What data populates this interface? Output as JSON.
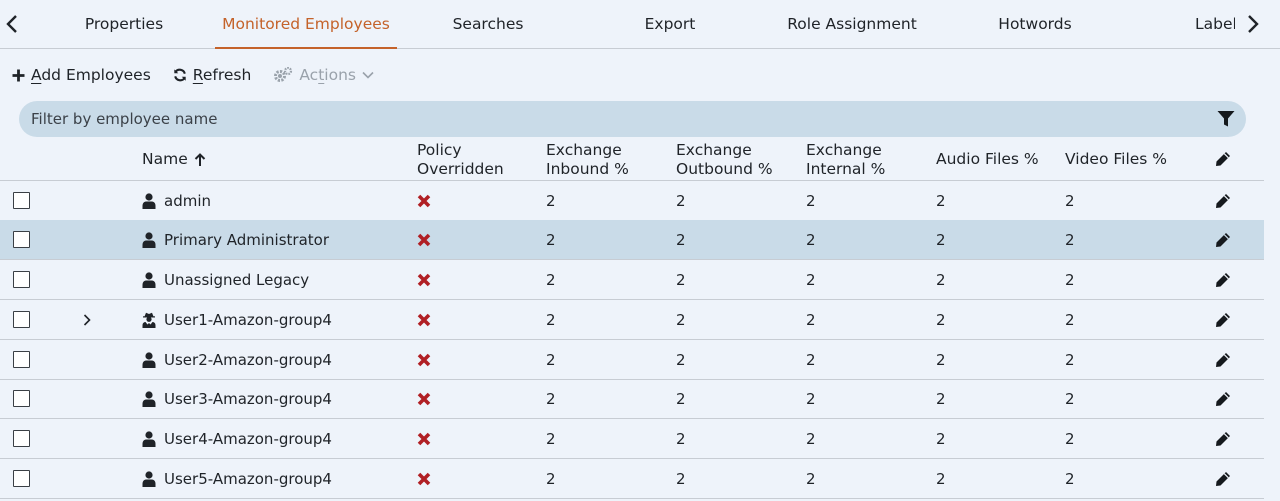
{
  "tabs": [
    {
      "label": "Properties",
      "active": false
    },
    {
      "label": "Monitored Employees",
      "active": true
    },
    {
      "label": "Searches",
      "active": false
    },
    {
      "label": "Export",
      "active": false
    },
    {
      "label": "Role Assignment",
      "active": false
    },
    {
      "label": "Hotwords",
      "active": false
    },
    {
      "label": "Labels",
      "active": false
    }
  ],
  "toolbar": {
    "add_prefix": "",
    "add_u": "A",
    "add_rest": "dd Employees",
    "refresh_u": "R",
    "refresh_rest": "efresh",
    "actions_pre": "Ac",
    "actions_u": "t",
    "actions_rest": "ions"
  },
  "filter": {
    "placeholder": "Filter by employee name",
    "value": ""
  },
  "columns": {
    "name": "Name",
    "policy_l1": "Policy",
    "policy_l2": "Overridden",
    "inbound_l1": "Exchange",
    "inbound_l2": "Inbound %",
    "outbound_l1": "Exchange",
    "outbound_l2": "Outbound %",
    "internal_l1": "Exchange",
    "internal_l2": "Internal %",
    "audio": "Audio Files %",
    "video": "Video Files %"
  },
  "rows": [
    {
      "name": "admin",
      "icon": "user-icon",
      "selected": false,
      "expandable": false,
      "inbound": "2",
      "outbound": "2",
      "internal": "2",
      "audio": "2",
      "video": "2"
    },
    {
      "name": "Primary Administrator",
      "icon": "user-icon",
      "selected": true,
      "expandable": false,
      "inbound": "2",
      "outbound": "2",
      "internal": "2",
      "audio": "2",
      "video": "2"
    },
    {
      "name": "Unassigned Legacy",
      "icon": "user-icon",
      "selected": false,
      "expandable": false,
      "inbound": "2",
      "outbound": "2",
      "internal": "2",
      "audio": "2",
      "video": "2"
    },
    {
      "name": "User1-Amazon-group4",
      "icon": "user-secret-icon",
      "selected": false,
      "expandable": true,
      "inbound": "2",
      "outbound": "2",
      "internal": "2",
      "audio": "2",
      "video": "2"
    },
    {
      "name": "User2-Amazon-group4",
      "icon": "user-icon",
      "selected": false,
      "expandable": false,
      "inbound": "2",
      "outbound": "2",
      "internal": "2",
      "audio": "2",
      "video": "2"
    },
    {
      "name": "User3-Amazon-group4",
      "icon": "user-icon",
      "selected": false,
      "expandable": false,
      "inbound": "2",
      "outbound": "2",
      "internal": "2",
      "audio": "2",
      "video": "2"
    },
    {
      "name": "User4-Amazon-group4",
      "icon": "user-icon",
      "selected": false,
      "expandable": false,
      "inbound": "2",
      "outbound": "2",
      "internal": "2",
      "audio": "2",
      "video": "2"
    },
    {
      "name": "User5-Amazon-group4",
      "icon": "user-icon",
      "selected": false,
      "expandable": false,
      "inbound": "2",
      "outbound": "2",
      "internal": "2",
      "audio": "2",
      "video": "2"
    }
  ],
  "colors": {
    "accent": "#c4622a",
    "selected_row": "#c9dbe8",
    "x_mark": "#b01f24"
  }
}
